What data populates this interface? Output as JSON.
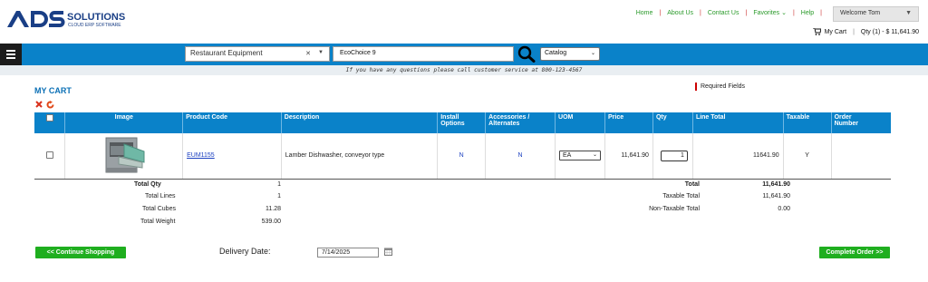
{
  "brand": {
    "name": "SOLUTIONS",
    "tagline": "CLOUD ERP SOFTWARE",
    "logo_letters": "ADS"
  },
  "top_nav": [
    "Home",
    "About Us",
    "Contact Us",
    "Favorites",
    "Help"
  ],
  "welcome": {
    "label": "Welcome Tom"
  },
  "cart_link": {
    "label": "My Cart",
    "summary": "Qty (1) - $ 11,641.90"
  },
  "search": {
    "category": "Restaurant Equipment",
    "query": "EcoChoice 9",
    "scope": "Catalog"
  },
  "notice": "If you have any questions please call customer service at 800-123-4567",
  "page_title": "MY CART",
  "required_label": "Required Fields",
  "table": {
    "headers": {
      "image": "Image",
      "code": "Product Code",
      "desc": "Description",
      "install1": "Install",
      "install2": "Options",
      "acc1": "Accessories /",
      "acc2": "Alternates",
      "uom": "UOM",
      "price": "Price",
      "qty": "Qty",
      "line_total": "Line Total",
      "taxable": "Taxable",
      "order1": "Order",
      "order2": "Number"
    },
    "rows": [
      {
        "code": "EUM1155",
        "desc": "Lamber Dishwasher, conveyor type",
        "install": "N",
        "accessories": "N",
        "uom": "EA",
        "price": "11,641.90",
        "qty": "1",
        "line_total": "11641.90",
        "taxable": "Y",
        "order_number": ""
      }
    ]
  },
  "totals_left": {
    "total_qty_label": "Total Qty",
    "total_qty": "1",
    "total_lines_label": "Total Lines",
    "total_lines": "1",
    "total_cubes_label": "Total Cubes",
    "total_cubes": "11.28",
    "total_weight_label": "Total Weight",
    "total_weight": "539.00"
  },
  "totals_right": {
    "total_label": "Total",
    "total": "11,641.90",
    "taxable_label": "Taxable Total",
    "taxable": "11,641.90",
    "nontaxable_label": "Non-Taxable Total",
    "nontaxable": "0.00"
  },
  "continue_button": "<< Continue Shopping",
  "delivery": {
    "label": "Delivery Date:",
    "value": "7/14/2025"
  },
  "complete_button": "Complete Order >>",
  "colors": {
    "accent": "#0a82c9",
    "green": "#1fae1f",
    "link": "#1a3fc0"
  }
}
